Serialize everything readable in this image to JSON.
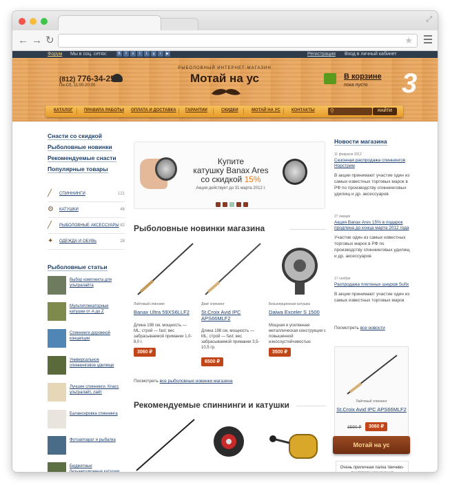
{
  "browser": {
    "traffic_lights": [
      "#f2564c",
      "#f6bd3b",
      "#3fc44a"
    ]
  },
  "topbar": {
    "forum": "Форум",
    "social_label": "Мы в соц. сетях:",
    "social_icons": [
      "vk-icon",
      "facebook-icon",
      "odnoklassniki-icon",
      "twitter-icon",
      "livejournal-icon",
      "googleplus-icon",
      "rss-icon",
      "youtube-icon"
    ],
    "register": "Регистрация",
    "login": "Вход в личный кабинет"
  },
  "header": {
    "phone_code": "(812)",
    "phone_number": "776-34-25",
    "hours": "Пн-Сб, 11:00-20:00",
    "tagline": "РЫБОЛОВНЫЙ ИНТЕРНЕТ-МАГАЗИН",
    "logo": "Мотай на ус",
    "cart_title": "В корзине",
    "cart_sub": "пока пусто",
    "scribble": "3"
  },
  "nav": {
    "items": [
      "КАТАЛОГ",
      "ПРАВИЛА РАБОТЫ",
      "ОПЛАТА И ДОСТАВКА",
      "ГАРАНТИИ",
      "СКИДКИ",
      "МОТАЙ НА УС",
      "КОНТАКТЫ"
    ],
    "search_button": "НАЙТИ"
  },
  "sidebar": {
    "links": [
      "Снасти со скидкой",
      "Рыболовные новинки",
      "Рекомендуемые снасти",
      "Популярные товары"
    ],
    "categories": [
      {
        "label": "СПИННИНГИ",
        "count": "121"
      },
      {
        "label": "КАТУШКИ",
        "count": "46"
      },
      {
        "label": "РЫБОЛОВНЫЕ АКСЕССУАРЫ",
        "count": "82"
      },
      {
        "label": "ОДЕЖДА И ОБУВЬ",
        "count": "28"
      }
    ],
    "articles_title": "Рыболовные статьи",
    "articles": [
      "Выбор комплекта для ультралайта",
      "Мультипликаторные катушки от А до Z",
      "Спиннинги дорожной концепции",
      "Универсальное спиннинговое удилище",
      "Лучшие спиннинги. Класс ультралайт, лайт",
      "Балансировка спиннинга",
      "Фотоаппарат и рыбалка",
      "Бюджетные безынерционные катушки"
    ]
  },
  "banner": {
    "line1": "Купите",
    "line2": "катушку Banax Ares",
    "line3": "со скидкой",
    "discount": "15%",
    "sub": "Акция действует до 31 марта 2012 г.",
    "pager_colors": [
      "#8a3a22",
      "#8a3a22",
      "#9ec8b4",
      "#8a3a22",
      "#8a3a22"
    ]
  },
  "new_products": {
    "title": "Рыболовные новинки магазина",
    "items": [
      {
        "kind": "Лайтовый спиннинг",
        "name": "Banax Ultra 59XS6LLF2",
        "desc": "Длина 198 см, мощность — ML; строй — fast; вес забрасываемой приманки 1,0-8,0 г.",
        "price": "3060 ₽"
      },
      {
        "kind": "Джиг спиннинг",
        "name": "St.Croix Avid IPC APS66MLF2",
        "desc": "Длина 198 см, мощность — ML; строй — fast; вес забрасываемой приманки 3,5-10,5 гр.",
        "price": "6500 ₽"
      },
      {
        "kind": "Безынерционная катушка",
        "name": "Daiwa Exceler S 1500",
        "desc": "Мощная и усиленная металлическая конструкция с повышенной износоустойчивостью",
        "price": "3500 ₽"
      }
    ],
    "see_all_prefix": "Посмотреть",
    "see_all_link": "все рыболовные новинки магазина"
  },
  "recommended": {
    "title": "Рекомендуемые спиннинги и катушки"
  },
  "news": {
    "title": "Новости магазина",
    "items": [
      {
        "date": "11 февраля 2012",
        "link": "Сезонная распродажа спиннингов Норстрим",
        "text": "В акции принимают участие один из самых известных торговых марок в РФ по производству спиннинговых удилищ и др. аксессуаров"
      },
      {
        "date": "27 января",
        "link": "Акция Banax Ares 15% в подарок продлена до конца марта 2012 года",
        "text": "Участие один из самых известных торговых марок в РФ по производству спиннинговых удилищ и др. аксессуаров"
      },
      {
        "date": "17 ноября",
        "link": "Распродажа плетеных шнуров Sufix",
        "text": "В акции принимают участие один из самых известных торговых марок"
      }
    ],
    "see_all_prefix": "Посмотреть",
    "see_all_link": "все новости"
  },
  "promo": {
    "kind": "Лайтовый спиннинг",
    "name": "St.Croix Avid IPC APS66MLF2",
    "old_price": "3590 ₽",
    "price": "3060 ₽",
    "brand": "Мотай на ус",
    "quote": "Очень приличная палка твичево-джигового назначения"
  }
}
